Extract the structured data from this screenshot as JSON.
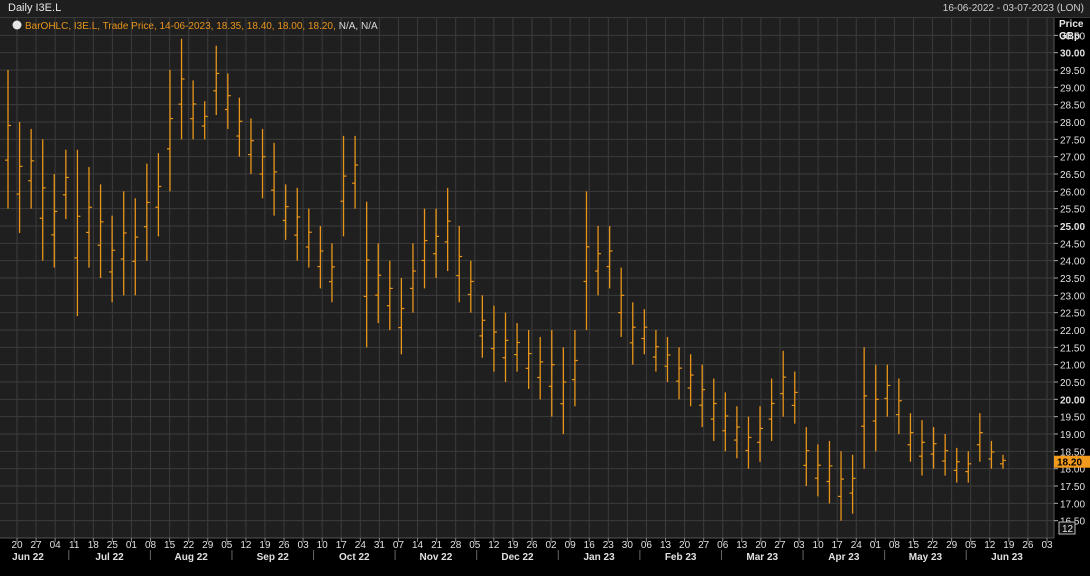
{
  "window": {
    "title": "Daily I3E.L",
    "date_range": "16-06-2022 - 03-07-2023 (LON)"
  },
  "legend": {
    "prefix": "BarOHLC, I3E.L, Trade Price, 14-06-2023, 18.35, 18.40, 18.00, 18.20,",
    "suffix": "N/A, N/A"
  },
  "axis": {
    "unit_line1": "Price",
    "unit_line2": "GBp",
    "last_price": "18.20",
    "corner": "12"
  },
  "colors": {
    "background": "#1f1f1f",
    "grid": "#3c3c3c",
    "bars": "#e8951a",
    "last_price_bg": "#f29a1c"
  },
  "chart_data": {
    "type": "ohlc",
    "series_name": "I3E.L",
    "ylim": [
      16.0,
      31.0
    ],
    "y_ticks": [
      16.5,
      17.0,
      17.5,
      18.0,
      18.5,
      19.0,
      19.5,
      20.0,
      20.5,
      21.0,
      21.5,
      22.0,
      22.5,
      23.0,
      23.5,
      24.0,
      24.5,
      25.0,
      25.5,
      26.0,
      26.5,
      27.0,
      27.5,
      28.0,
      28.5,
      29.0,
      29.5,
      30.0,
      30.5
    ],
    "y_tick_labels": [
      "16.50",
      "17.00",
      "17.50",
      "18.00",
      "18.50",
      "19.00",
      "19.50",
      "20.00",
      "20.50",
      "21.00",
      "21.50",
      "22.00",
      "22.50",
      "23.00",
      "23.50",
      "24.00",
      "24.50",
      "25.00",
      "25.50",
      "26.00",
      "26.50",
      "27.00",
      "27.50",
      "28.00",
      "28.50",
      "29.00",
      "29.50",
      "30.00",
      "30.50"
    ],
    "y_bold_ticks": [
      "20.00",
      "25.00",
      "30.00"
    ],
    "x_day_labels": [
      "20",
      "27",
      "04",
      "11",
      "18",
      "25",
      "01",
      "08",
      "15",
      "22",
      "29",
      "05",
      "12",
      "19",
      "26",
      "03",
      "10",
      "17",
      "24",
      "31",
      "07",
      "14",
      "21",
      "28",
      "05",
      "12",
      "19",
      "26",
      "02",
      "09",
      "16",
      "23",
      "30",
      "06",
      "13",
      "20",
      "27",
      "06",
      "13",
      "20",
      "27",
      "03",
      "10",
      "17",
      "24",
      "01",
      "08",
      "15",
      "22",
      "29",
      "05",
      "12",
      "19",
      "26",
      "03"
    ],
    "x_month_labels": [
      "Jun 22",
      "Jul 22",
      "Aug 22",
      "Sep 22",
      "Oct 22",
      "Nov 22",
      "Dec 22",
      "Jan 23",
      "Feb 23",
      "Mar 23",
      "Apr 23",
      "May 23",
      "Jun 23"
    ],
    "bars_high_low": [
      [
        25.5,
        29.5
      ],
      [
        24.8,
        28.0
      ],
      [
        25.5,
        27.8
      ],
      [
        24.0,
        27.5
      ],
      [
        23.8,
        26.5
      ],
      [
        25.2,
        27.2
      ],
      [
        22.4,
        27.2
      ],
      [
        23.8,
        26.7
      ],
      [
        23.5,
        26.2
      ],
      [
        22.8,
        25.3
      ],
      [
        23.0,
        26.0
      ],
      [
        23.0,
        25.8
      ],
      [
        24.0,
        26.8
      ],
      [
        24.7,
        27.1
      ],
      [
        26.0,
        29.5
      ],
      [
        27.5,
        30.4
      ],
      [
        27.5,
        29.2
      ],
      [
        27.5,
        28.6
      ],
      [
        28.2,
        30.2
      ],
      [
        27.8,
        29.4
      ],
      [
        27.0,
        28.7
      ],
      [
        26.5,
        28.1
      ],
      [
        25.8,
        27.8
      ],
      [
        25.3,
        27.4
      ],
      [
        24.6,
        26.2
      ],
      [
        24.0,
        26.1
      ],
      [
        23.8,
        25.5
      ],
      [
        23.2,
        25.0
      ],
      [
        22.8,
        24.5
      ],
      [
        24.7,
        27.6
      ],
      [
        25.5,
        27.6
      ],
      [
        21.5,
        25.7
      ],
      [
        22.2,
        24.5
      ],
      [
        22.0,
        24.0
      ],
      [
        21.3,
        23.5
      ],
      [
        22.5,
        24.5
      ],
      [
        23.2,
        25.5
      ],
      [
        23.5,
        25.5
      ],
      [
        23.7,
        26.1
      ],
      [
        22.8,
        25.0
      ],
      [
        22.5,
        24.0
      ],
      [
        21.2,
        23.0
      ],
      [
        20.8,
        22.7
      ],
      [
        20.5,
        22.5
      ],
      [
        20.8,
        22.2
      ],
      [
        20.3,
        22.0
      ],
      [
        20.0,
        21.8
      ],
      [
        19.5,
        22.0
      ],
      [
        19.0,
        21.5
      ],
      [
        19.8,
        22.0
      ],
      [
        22.0,
        26.0
      ],
      [
        23.0,
        25.0
      ],
      [
        23.2,
        25.0
      ],
      [
        21.8,
        23.8
      ],
      [
        21.0,
        22.8
      ],
      [
        21.3,
        22.6
      ],
      [
        20.8,
        22.0
      ],
      [
        20.5,
        21.8
      ],
      [
        20.0,
        21.5
      ],
      [
        19.8,
        21.3
      ],
      [
        19.2,
        21.0
      ],
      [
        18.8,
        20.6
      ],
      [
        18.5,
        20.2
      ],
      [
        18.3,
        19.8
      ],
      [
        18.0,
        19.5
      ],
      [
        18.2,
        19.8
      ],
      [
        18.8,
        20.6
      ],
      [
        19.5,
        21.4
      ],
      [
        19.3,
        20.8
      ],
      [
        17.5,
        19.2
      ],
      [
        17.2,
        18.7
      ],
      [
        17.0,
        18.8
      ],
      [
        16.5,
        18.5
      ],
      [
        16.7,
        18.4
      ],
      [
        18.0,
        21.5
      ],
      [
        18.5,
        21.0
      ],
      [
        19.5,
        21.0
      ],
      [
        19.0,
        20.6
      ],
      [
        18.2,
        19.6
      ],
      [
        17.8,
        19.4
      ],
      [
        18.0,
        19.2
      ],
      [
        17.8,
        19.0
      ],
      [
        17.6,
        18.6
      ],
      [
        17.6,
        18.5
      ],
      [
        18.2,
        19.6
      ],
      [
        18.0,
        18.8
      ],
      [
        18.0,
        18.4
      ]
    ]
  }
}
